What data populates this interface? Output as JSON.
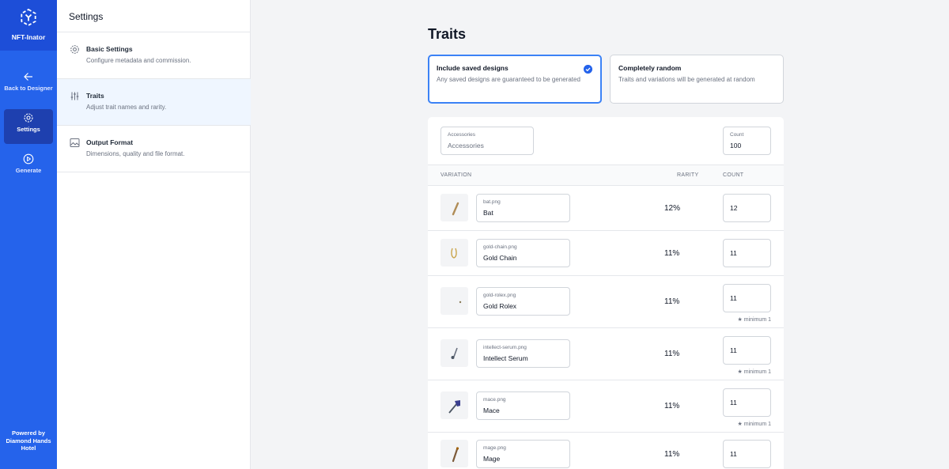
{
  "app": {
    "name": "NFT-Inator",
    "footer": "Powered by Diamond Hands Hotel",
    "accent": "#2563eb",
    "accent_dark": "#1d4ed8"
  },
  "rail": {
    "items": [
      {
        "label": "Back to Designer",
        "icon": "arrow-left-icon",
        "active": false
      },
      {
        "label": "Settings",
        "icon": "gear-icon",
        "active": true
      },
      {
        "label": "Generate",
        "icon": "play-circle-icon",
        "active": false
      }
    ]
  },
  "settings_panel": {
    "title": "Settings",
    "items": [
      {
        "title": "Basic Settings",
        "description": "Configure metadata and commission.",
        "icon": "gear-icon",
        "active": false
      },
      {
        "title": "Traits",
        "description": "Adjust trait names and rarity.",
        "icon": "sliders-icon",
        "active": true
      },
      {
        "title": "Output Format",
        "description": "Dimensions, quality and file format.",
        "icon": "image-icon",
        "active": false
      }
    ]
  },
  "main": {
    "title": "Traits",
    "options": [
      {
        "title": "Include saved designs",
        "description": "Any saved designs are guaranteed to be generated",
        "selected": true
      },
      {
        "title": "Completely random",
        "description": "Traits and variations will be generated at random",
        "selected": false
      }
    ],
    "trait": {
      "name_label": "Accessories",
      "name_value": "Accessories",
      "count_label": "Count",
      "count_value": "100"
    },
    "columns": {
      "variation": "VARIATION",
      "rarity": "RARITY",
      "count": "COUNT"
    },
    "rows": [
      {
        "file": "bat.png",
        "name": "Bat",
        "rarity": "12%",
        "count": "12",
        "minimum": ""
      },
      {
        "file": "gold-chain.png",
        "name": "Gold Chain",
        "rarity": "11%",
        "count": "11",
        "minimum": ""
      },
      {
        "file": "gold-rolex.png",
        "name": "Gold Rolex",
        "rarity": "11%",
        "count": "11",
        "minimum": "★ minimum 1"
      },
      {
        "file": "intellect-serum.png",
        "name": "Intellect Serum",
        "rarity": "11%",
        "count": "11",
        "minimum": "★ minimum 1"
      },
      {
        "file": "mace.png",
        "name": "Mace",
        "rarity": "11%",
        "count": "11",
        "minimum": "★ minimum 1"
      },
      {
        "file": "mage.png",
        "name": "Mage",
        "rarity": "11%",
        "count": "11",
        "minimum": ""
      }
    ]
  }
}
